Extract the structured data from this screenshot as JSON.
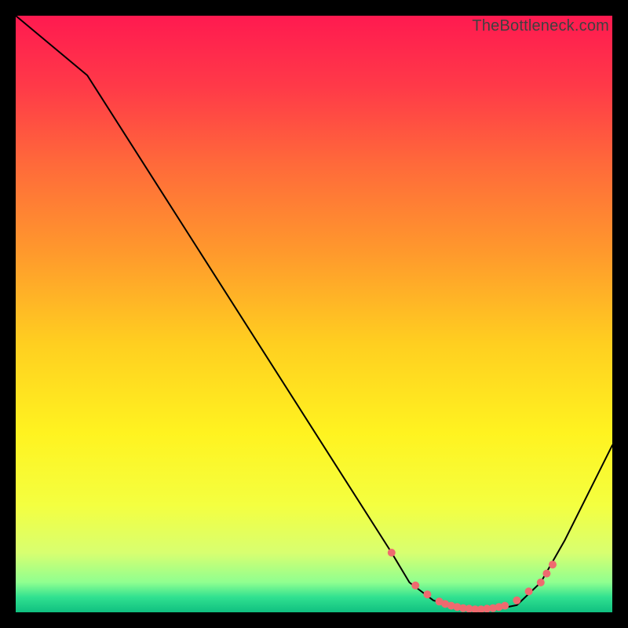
{
  "watermark": "TheBottleneck.com",
  "chart_data": {
    "type": "line",
    "title": "",
    "xlabel": "",
    "ylabel": "",
    "xlim": [
      0,
      100
    ],
    "ylim": [
      0,
      100
    ],
    "grid": false,
    "legend": false,
    "gradient_stops": [
      {
        "offset": 0.0,
        "color": "#ff1a50"
      },
      {
        "offset": 0.12,
        "color": "#ff3a48"
      },
      {
        "offset": 0.25,
        "color": "#ff6a3a"
      },
      {
        "offset": 0.4,
        "color": "#ff9a2c"
      },
      {
        "offset": 0.55,
        "color": "#ffcf20"
      },
      {
        "offset": 0.7,
        "color": "#fff320"
      },
      {
        "offset": 0.82,
        "color": "#f4ff40"
      },
      {
        "offset": 0.9,
        "color": "#d8ff70"
      },
      {
        "offset": 0.95,
        "color": "#8fff90"
      },
      {
        "offset": 0.975,
        "color": "#30e090"
      },
      {
        "offset": 1.0,
        "color": "#10c080"
      }
    ],
    "series": [
      {
        "name": "bottleneck-curve",
        "type": "line",
        "color": "#000000",
        "x": [
          0,
          12,
          63,
          66,
          70,
          74,
          78,
          82,
          84,
          88,
          92,
          100
        ],
        "y": [
          100,
          90,
          10,
          5,
          2,
          0.8,
          0.5,
          0.8,
          1.2,
          5,
          12,
          28
        ]
      },
      {
        "name": "highlight-markers",
        "type": "scatter",
        "color": "#ef6a6f",
        "x": [
          63,
          67,
          69,
          71,
          72,
          73,
          74,
          75,
          76,
          77,
          78,
          79,
          80,
          81,
          82,
          84,
          86,
          88,
          89,
          90
        ],
        "y": [
          10,
          4.5,
          3.0,
          1.8,
          1.4,
          1.1,
          0.9,
          0.7,
          0.6,
          0.5,
          0.5,
          0.6,
          0.7,
          0.9,
          1.1,
          2.0,
          3.5,
          5.0,
          6.5,
          8.0
        ]
      }
    ]
  }
}
